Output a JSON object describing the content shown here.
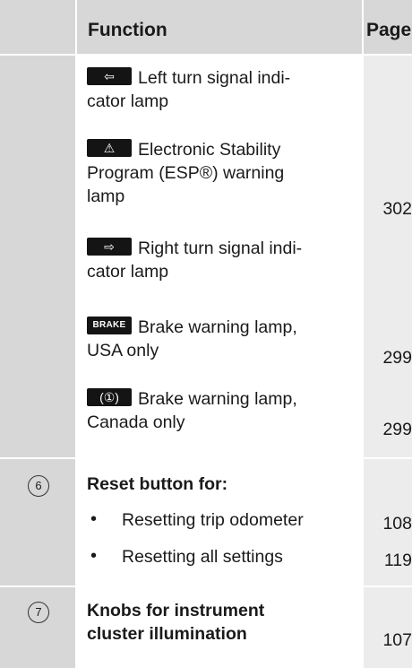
{
  "header": {
    "function_label": "Function",
    "page_label": "Page"
  },
  "lamps": [
    {
      "icon": "left-arrow-icon",
      "glyph": "⇦",
      "text_line1": "Left turn signal indi-",
      "text_line2": "cator lamp",
      "page": ""
    },
    {
      "icon": "warning-triangle-icon",
      "glyph": "⚠",
      "text_line1": "Electronic Stability",
      "text_line2": "Program (ESP®) warning",
      "text_line3": "lamp",
      "page": "302"
    },
    {
      "icon": "right-arrow-icon",
      "glyph": "⇨",
      "text_line1": "Right turn signal indi-",
      "text_line2": "cator lamp",
      "page": ""
    },
    {
      "icon": "brake-text-icon",
      "glyph": "BRAKE",
      "text_line1": "Brake warning lamp,",
      "text_line2": "USA only",
      "page": "299"
    },
    {
      "icon": "brake-circle-icon",
      "glyph": "(①)",
      "text_line1": "Brake warning lamp,",
      "text_line2": "Canada only",
      "page": "299"
    }
  ],
  "reset": {
    "number": "6",
    "title": "Reset button for:",
    "items": [
      {
        "label": "Resetting trip odometer",
        "page": "108"
      },
      {
        "label": "Resetting all settings",
        "page": "119"
      }
    ]
  },
  "knobs": {
    "number": "7",
    "title_line1": "Knobs for instrument",
    "title_line2": "cluster illumination",
    "page": "107"
  },
  "bullet_char": "•"
}
